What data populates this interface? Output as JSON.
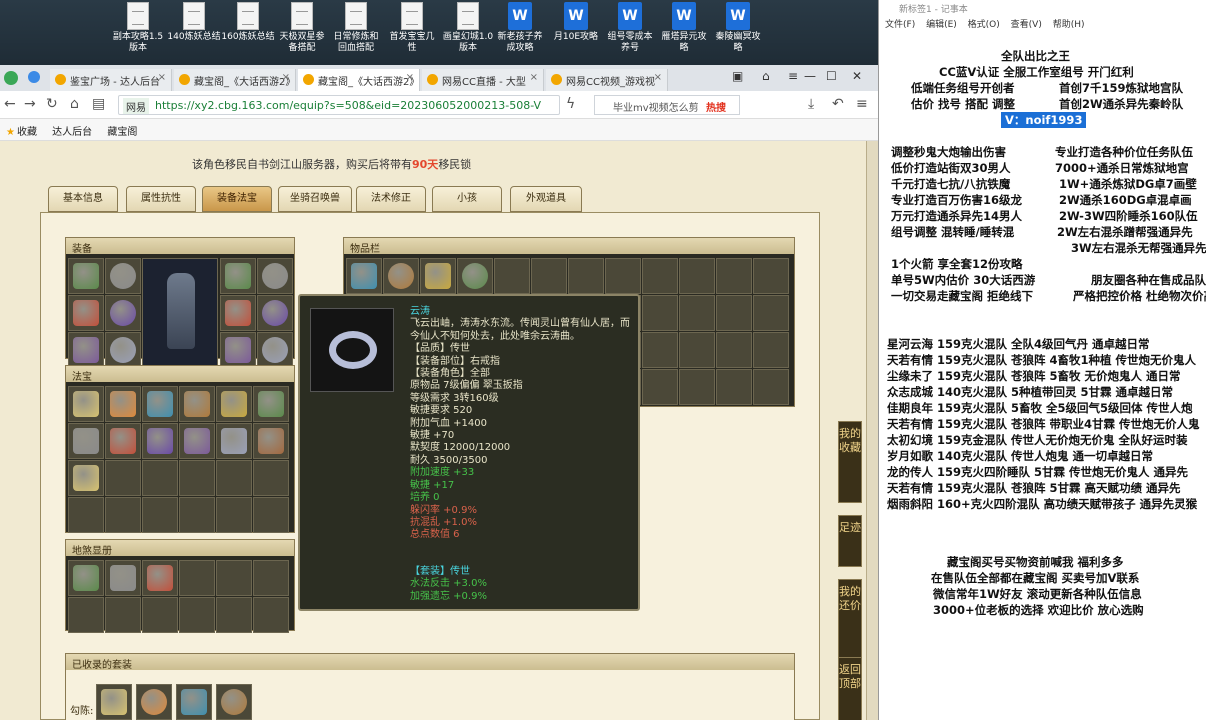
{
  "desktop": {
    "icons": [
      {
        "label": "副本攻略1.5\n版本"
      },
      {
        "label": "140炼妖总结"
      },
      {
        "label": "160炼妖总结"
      },
      {
        "label": "天极双星参\n备搭配"
      },
      {
        "label": "日常修炼和\n回血搭配"
      },
      {
        "label": "首发宝宝几\n性"
      },
      {
        "label": "画皇幻城1.0\n版本"
      },
      {
        "label": "新老孩子养\n成攻略"
      },
      {
        "label": "月10E攻略"
      },
      {
        "label": "组号零成本\n养号"
      },
      {
        "label": "雁塔异元攻\n略"
      },
      {
        "label": "秦陵幽冥攻\n略"
      }
    ]
  },
  "browser": {
    "tabs": [
      {
        "label": "鉴宝广场 - 达人后台",
        "active": false
      },
      {
        "label": "藏宝阁_《大话西游2》",
        "active": false
      },
      {
        "label": "藏宝阁_《大话西游2》",
        "active": true
      },
      {
        "label": "网易CC直播 - 大型",
        "active": false
      },
      {
        "label": "网易CC视频_游戏视",
        "active": false
      }
    ],
    "url_tag": "网易",
    "url": "https://xy2.cbg.163.com/equip?s=508&eid=202306052000213-508-V",
    "search_placeholder": "毕业mv视频怎么剪",
    "hot_label": "热搜",
    "bookmarks": [
      "收藏",
      "达人后台",
      "藏宝阁"
    ]
  },
  "page": {
    "notice_prefix": "该角色移民自书剑江山服务器，购买后将带有",
    "notice_days": "90天",
    "notice_suffix": "移民锁",
    "tabs": [
      "基本信息",
      "属性抗性",
      "装备法宝",
      "坐骑召唤兽",
      "法术修正",
      "小孩",
      "外观道具"
    ],
    "active_tab": "装备法宝",
    "section_equip": "装备",
    "section_fabao": "法宝",
    "section_linked": "地煞显册",
    "section_items": "物品栏",
    "section_suits": "已收录的套装",
    "suit_prefix": "勾陈:",
    "side_buttons": [
      "我的收藏",
      "足迹",
      "我的还价",
      "返回顶部"
    ]
  },
  "tooltip": {
    "name": "云涛",
    "desc1": "飞云出岫，涛涛水东流。传闻灵山曾有仙人居，而",
    "desc2": "今仙人不知何处去，此处唯余云涛曲。",
    "quality": "【品质】传世",
    "slot": "【装备部位】右戒指",
    "role": "【装备角色】全部",
    "origin": "原物品 7级偏偏 翠玉扳指",
    "level": "等级需求 3转160级",
    "agility_req": "敏捷要求 520",
    "hp": "附加气血 +1400",
    "agility": "敏捷 +70",
    "forge": "默契度 12000/12000",
    "durability": "耐久 3500/3500",
    "speed": "附加速度 +33",
    "agility2": "敏捷 +17",
    "train": "培养 0",
    "dodge": "躲闪率 +0.9%",
    "resist": "抗混乱 +1.0%",
    "total": "总点数值 6",
    "suit": "【套装】传世",
    "suit1": "水法反击 +3.0%",
    "suit2": "加强遗忘 +0.9%"
  },
  "notepad": {
    "title": "新标签1 - 记事本",
    "menu": [
      "文件(F)",
      "编辑(E)",
      "格式(O)",
      "查看(V)",
      "帮助(H)"
    ],
    "lines_top": [
      "全队出比之王",
      "CC蓝V认证  全服工作室组号  开门红利",
      "低端任务组号开创者",
      "估价 找号 搭配 调整"
    ],
    "lines_top_right": [
      "首创7千159炼狱地宫队",
      "首创2W通杀异先秦岭队"
    ],
    "contact": "V：noif1993",
    "left_col": [
      "调整秒鬼大炮输出伤害",
      "低价打造站街双30男人",
      "千元打造七抗/八抗铁魔",
      "专业打造百万伤害16级龙",
      "万元打造通杀异先14男人",
      "组号调整 混转睡/睡转混"
    ],
    "right_col": [
      "专业打造各种价位任务队伍",
      "7000+通杀日常炼狱地宫",
      "1W+通杀炼狱DG卓7画壁",
      "2W通杀160DG卓混卓画",
      "2W-3W四阶睡杀160队伍",
      "2W左右混杀蹭帮强通异先",
      "3W左右混杀无帮强通异先"
    ],
    "mid_left": [
      "1个火箭 享全套12份攻略",
      "单号5W内估价 30大话西游",
      "一切交易走藏宝阁 拒绝线下"
    ],
    "mid_right": [
      "朋友圈各种在售成品队伍",
      "严格把控价格 杜绝物次价高"
    ],
    "teams": [
      "星河云海 159克火混队 全队4级回气丹 通卓越日常",
      "天若有情 159克火混队 苍狼阵 4畜牧1种植 传世炮无价鬼人",
      "尘缘未了 159克火混队 苍狼阵 5畜牧 无价炮鬼人 通日常",
      "众志成城 140克火混队 5种植带回灵 5甘霖 通卓越日常",
      "佳期良年 159克火混队 5畜牧 全5级回气5级回体 传世人炮",
      "天若有情 159克火混队 苍狼阵 带职业4甘霖 传世炮无价人鬼",
      "太初幻境 159克金混队 传世人无价炮无价鬼 全队好运时装",
      "岁月如歌 140克火混队 传世人炮鬼 通一切卓越日常",
      "龙的传人 159克火四阶睡队 5甘霖 传世炮无价鬼人 通异先",
      "天若有情 159克火混队 苍狼阵 5甘霖 高天赋功绩 通异先",
      "烟雨斜阳 160+克火四阶混队 高功绩天赋带孩子 通异先灵猴"
    ],
    "footer": [
      "藏宝阁买号买物资前喊我 福利多多",
      "在售队伍全部都在藏宝阁 买卖号加V联系",
      "微信常年1W好友 滚动更新各种队伍信息",
      "3000+位老板的选择 欢迎比价 放心选购"
    ]
  }
}
